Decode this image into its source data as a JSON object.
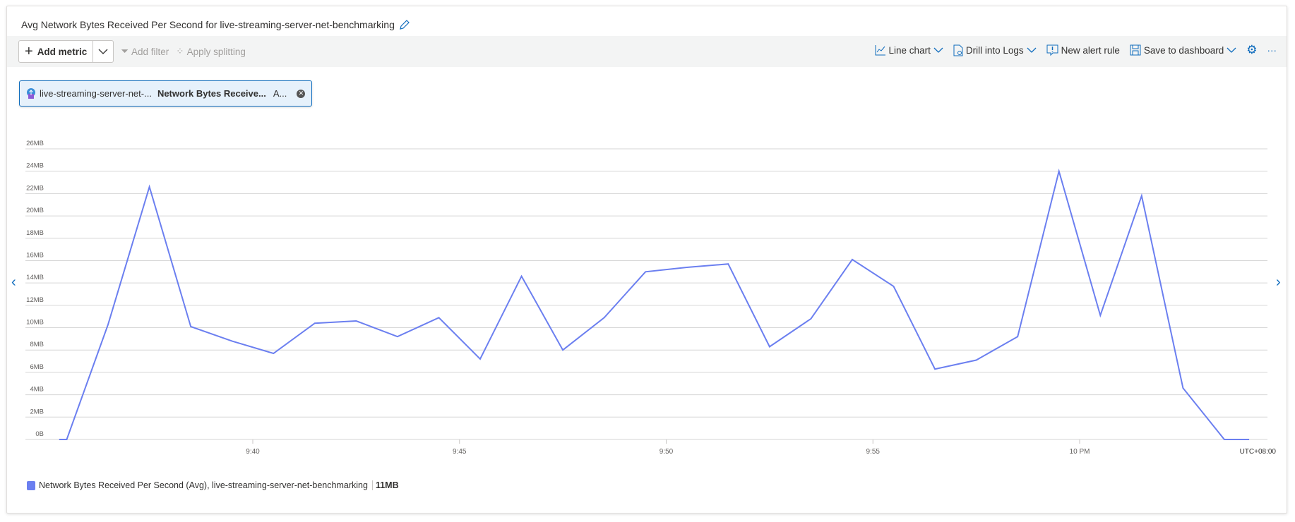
{
  "title": "Avg Network Bytes Received Per Second for live-streaming-server-net-benchmarking",
  "toolbar": {
    "add_metric": "Add metric",
    "add_filter": "Add filter",
    "apply_splitting": "Apply splitting",
    "line_chart": "Line chart",
    "drill_logs": "Drill into Logs",
    "new_alert": "New alert rule",
    "save_dashboard": "Save to dashboard",
    "more": "···"
  },
  "chip": {
    "resource": "live-streaming-server-net-...",
    "metric": "Network Bytes Receive...",
    "aggregation": "A..."
  },
  "colors": {
    "accent": "#0f6cbd",
    "series": "#6b7ff0",
    "chip_bg": "#e6f1fb"
  },
  "chart_data": {
    "type": "line",
    "ylim": [
      0,
      26
    ],
    "yunit": "MB",
    "y_ticks": [
      "0B",
      "2MB",
      "4MB",
      "6MB",
      "8MB",
      "10MB",
      "12MB",
      "14MB",
      "16MB",
      "18MB",
      "20MB",
      "22MB",
      "24MB",
      "26MB"
    ],
    "x_ticks": [
      {
        "t": "21:40:00",
        "label": "9:40"
      },
      {
        "t": "21:45:00",
        "label": "9:45"
      },
      {
        "t": "21:50:00",
        "label": "9:50"
      },
      {
        "t": "21:55:00",
        "label": "9:55"
      },
      {
        "t": "22:00:00",
        "label": "10 PM"
      }
    ],
    "timezone": "UTC+08:00",
    "grid": true,
    "series": [
      {
        "name": "Network Bytes Received Per Second (Avg), live-streaming-server-net-benchmarking",
        "summary": "11MB",
        "x": [
          "21:35:19",
          "21:35:30",
          "21:36:30",
          "21:37:30",
          "21:38:30",
          "21:39:30",
          "21:40:30",
          "21:41:30",
          "21:42:30",
          "21:43:30",
          "21:44:30",
          "21:45:30",
          "21:46:30",
          "21:47:30",
          "21:48:30",
          "21:49:30",
          "21:50:30",
          "21:51:30",
          "21:52:30",
          "21:53:30",
          "21:54:30",
          "21:55:30",
          "21:56:30",
          "21:57:30",
          "21:58:30",
          "21:59:30",
          "22:00:30",
          "22:01:30",
          "22:02:30",
          "22:03:30",
          "22:04:06"
        ],
        "values": [
          0,
          0,
          10.3,
          22.6,
          10.1,
          8.8,
          7.7,
          10.4,
          10.6,
          9.2,
          10.9,
          7.2,
          14.6,
          8.0,
          10.9,
          15.0,
          15.4,
          15.7,
          8.3,
          10.8,
          16.1,
          13.7,
          6.3,
          7.1,
          9.2,
          24.0,
          11.1,
          21.8,
          4.6,
          0,
          0
        ]
      }
    ],
    "legend_position": "bottom-left"
  }
}
